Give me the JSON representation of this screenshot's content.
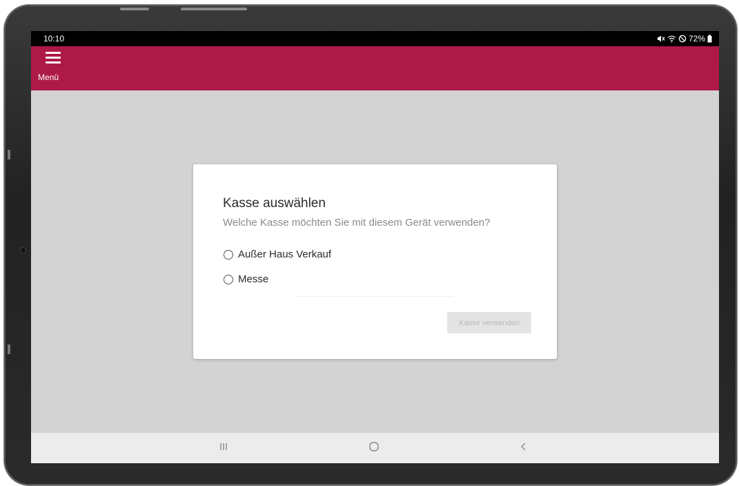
{
  "status_bar": {
    "time": "10:10",
    "battery_text": "72%",
    "icons": [
      "mute-icon",
      "wifi-icon",
      "do-not-disturb-icon",
      "battery-icon"
    ]
  },
  "app_bar": {
    "menu_label": "Menü",
    "background_color": "#ae1a48"
  },
  "dialog": {
    "title": "Kasse auswählen",
    "subtitle": "Welche Kasse möchten Sie mit diesem Gerät verwenden?",
    "options": [
      {
        "label": "Außer Haus Verkauf",
        "selected": false
      },
      {
        "label": "Messe",
        "selected": false
      }
    ],
    "submit_label": "Kasse verwenden",
    "submit_enabled": false
  },
  "nav_bar": {
    "buttons": [
      "recent-apps-icon",
      "home-icon",
      "back-icon"
    ]
  }
}
